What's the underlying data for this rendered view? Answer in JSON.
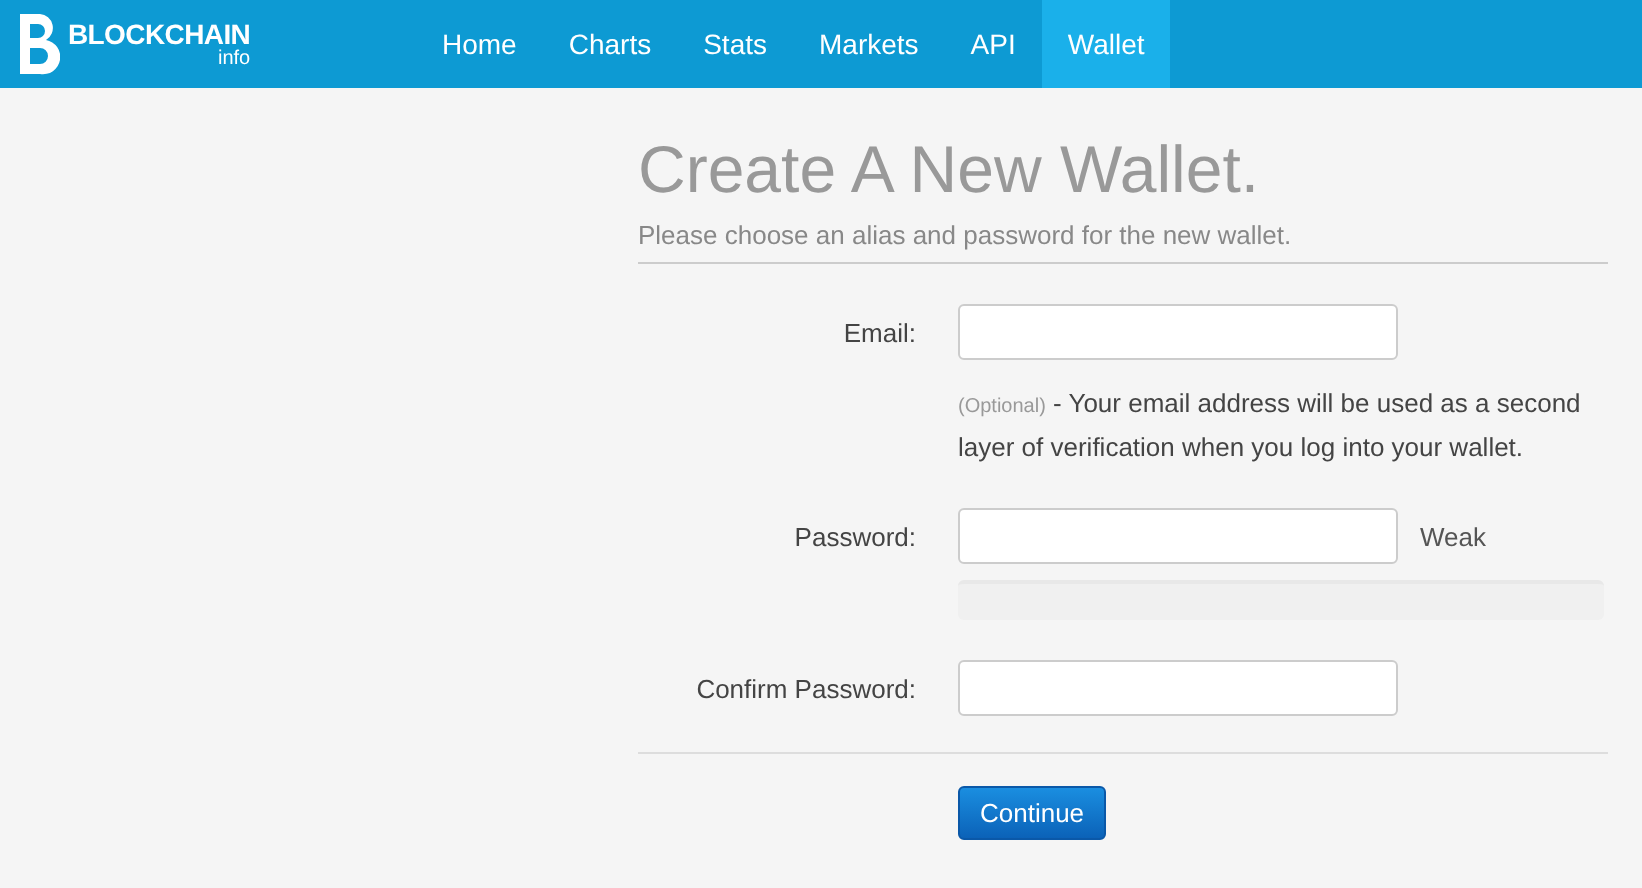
{
  "brand": {
    "name": "BLOCKCHAIN",
    "sub": "info"
  },
  "nav": [
    {
      "label": "Home",
      "selected": false
    },
    {
      "label": "Charts",
      "selected": false
    },
    {
      "label": "Stats",
      "selected": false
    },
    {
      "label": "Markets",
      "selected": false
    },
    {
      "label": "API",
      "selected": false
    },
    {
      "label": "Wallet",
      "selected": true
    }
  ],
  "heading": "Create A New Wallet.",
  "subheading": "Please choose an alias and password for the new wallet.",
  "fields": [
    {
      "label": "Email:",
      "hint_tag": "(Optional)",
      "hint": " - Your email address will be used as a second layer of verification when you log into your wallet."
    },
    {
      "label": "Password:",
      "strength": "Weak"
    },
    {
      "label": "Confirm Password:"
    }
  ],
  "submit": "Continue"
}
